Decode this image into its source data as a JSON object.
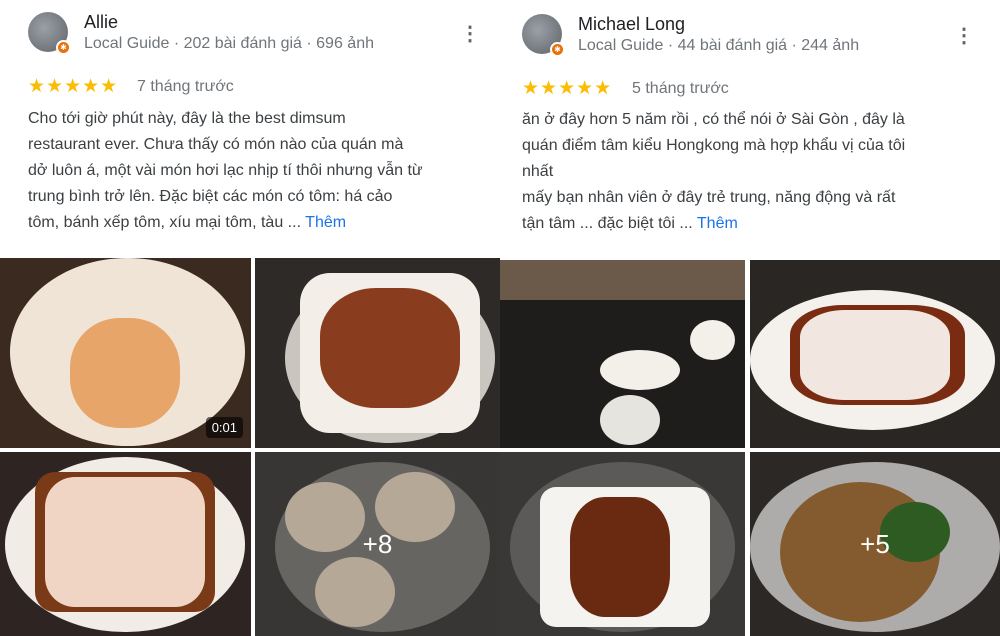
{
  "reviews": [
    {
      "name": "Allie",
      "meta": "Local Guide · 202 bài đánh giá · 696 ảnh",
      "rating": 5,
      "stars": "★★★★★",
      "date": "7 tháng trước",
      "text": "Cho tới giờ phút này, đây là the best dimsum\nrestaurant ever. Chưa thấy có món nào của quán mà\ndở luôn á, một vài món hơi lạc nhịp tí thôi nhưng vẫn từ\ntrung bình trở lên. Đặc biệt các món có tôm: há cảo\ntôm, bánh xếp tôm, xíu mại tôm, tàu ... ",
      "more_label": "Thêm",
      "video_duration": "0:01",
      "more_photos": "+8"
    },
    {
      "name": "Michael Long",
      "meta": "Local Guide · 44 bài đánh giá · 244 ảnh",
      "rating": 5,
      "stars": "★★★★★",
      "date": "5 tháng trước",
      "text": "ăn ở đây hơn 5 năm rồi , có thể nói ở Sài Gòn , đây là\nquán điểm tâm kiểu Hongkong mà hợp khẩu vị của tôi\nnhất\nmấy bạn nhân viên ở đây trẻ trung,  năng động và rất\ntận tâm ... đặc biệt tôi ... ",
      "more_label": "Thêm",
      "more_photos": "+5"
    }
  ],
  "menu_icon": "⋮",
  "colors": {
    "star": "#fbbc04",
    "link": "#1a73e8",
    "badge": "#e8710a"
  }
}
